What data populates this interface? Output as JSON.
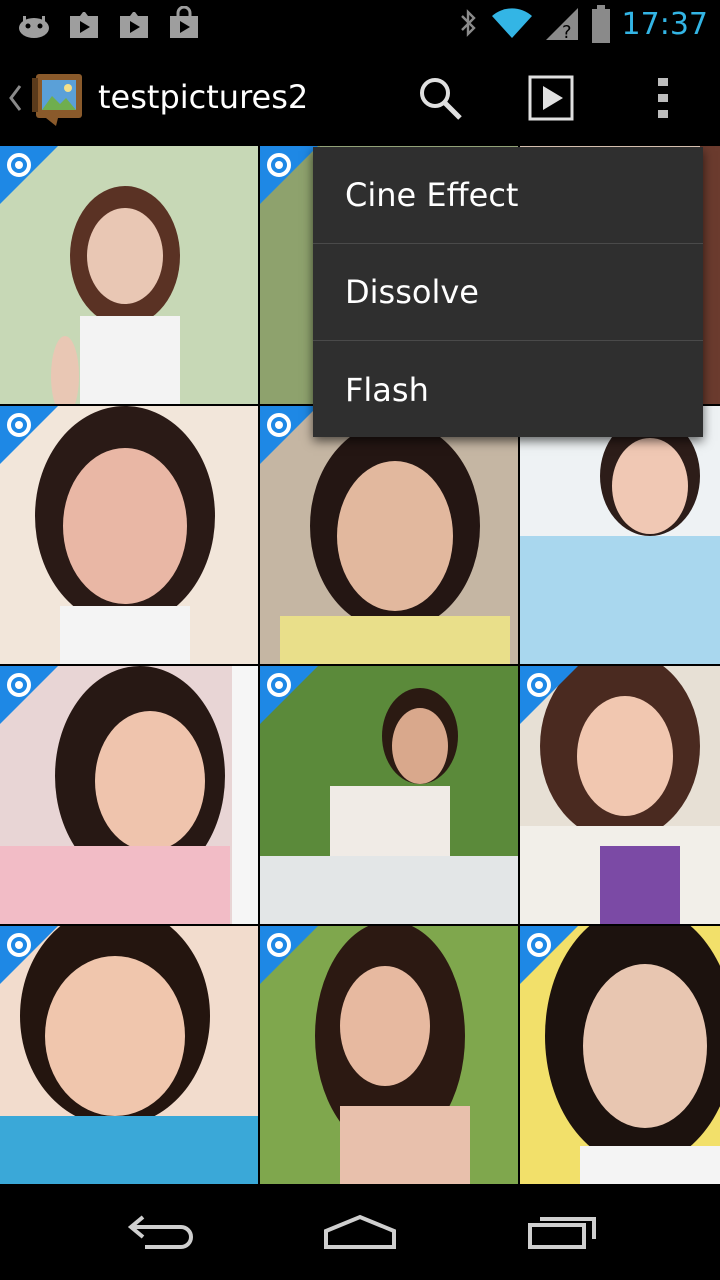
{
  "status_bar": {
    "time": "17:37",
    "left_icons": [
      "android-notification-icon",
      "play-store-icon",
      "play-store-icon",
      "shopping-bag-icon"
    ],
    "right_icons": [
      "bluetooth-icon",
      "wifi-icon",
      "signal-icon",
      "battery-icon"
    ]
  },
  "action_bar": {
    "title": "testpictures2",
    "icons": [
      "up-caret-icon",
      "album-app-icon",
      "search-icon",
      "slideshow-icon",
      "overflow-menu-icon"
    ]
  },
  "menu": {
    "items": [
      {
        "label": "Cine Effect"
      },
      {
        "label": "Dissolve"
      },
      {
        "label": "Flash"
      }
    ]
  },
  "grid": {
    "tiles": [
      {
        "icon": "photo-thumbnail",
        "badge": "camera-badge-icon",
        "colors": [
          "#c7d8b6",
          "#e9c7b4"
        ]
      },
      {
        "icon": "photo-thumbnail",
        "badge": "camera-badge-icon",
        "colors": [
          "#a6b889",
          "#d6b397"
        ]
      },
      {
        "icon": "photo-thumbnail",
        "badge": "none",
        "colors": [
          "#f1d7c6",
          "#6b3b2e"
        ]
      },
      {
        "icon": "photo-thumbnail",
        "badge": "camera-badge-icon",
        "colors": [
          "#f2e6da",
          "#e9b7a5"
        ]
      },
      {
        "icon": "photo-thumbnail",
        "badge": "camera-badge-icon",
        "colors": [
          "#c5b6a3",
          "#e2b89e"
        ]
      },
      {
        "icon": "photo-thumbnail",
        "badge": "camera-badge-icon",
        "colors": [
          "#eef2f4",
          "#a9d7ee"
        ]
      },
      {
        "icon": "photo-thumbnail",
        "badge": "camera-badge-icon",
        "colors": [
          "#e8d5d5",
          "#f2bcc6"
        ]
      },
      {
        "icon": "photo-thumbnail",
        "badge": "camera-badge-icon",
        "colors": [
          "#5b8a3a",
          "#f0ebe6"
        ]
      },
      {
        "icon": "photo-thumbnail",
        "badge": "camera-badge-icon",
        "colors": [
          "#e7e0d5",
          "#7b4aa5"
        ]
      },
      {
        "icon": "photo-thumbnail",
        "badge": "camera-badge-icon",
        "colors": [
          "#f2dccd",
          "#3aa8d8"
        ]
      },
      {
        "icon": "photo-thumbnail",
        "badge": "camera-badge-icon",
        "colors": [
          "#7fa74d",
          "#e7b9a0"
        ]
      },
      {
        "icon": "photo-thumbnail",
        "badge": "camera-badge-icon",
        "colors": [
          "#f2e06a",
          "#e8c6b1"
        ]
      }
    ]
  },
  "nav_bar": {
    "icons": [
      "back-icon",
      "home-icon",
      "recent-apps-icon"
    ]
  },
  "colors": {
    "accent": "#33b5e5",
    "badge": "#1e88e5",
    "menu_bg": "#2f2f2f"
  }
}
